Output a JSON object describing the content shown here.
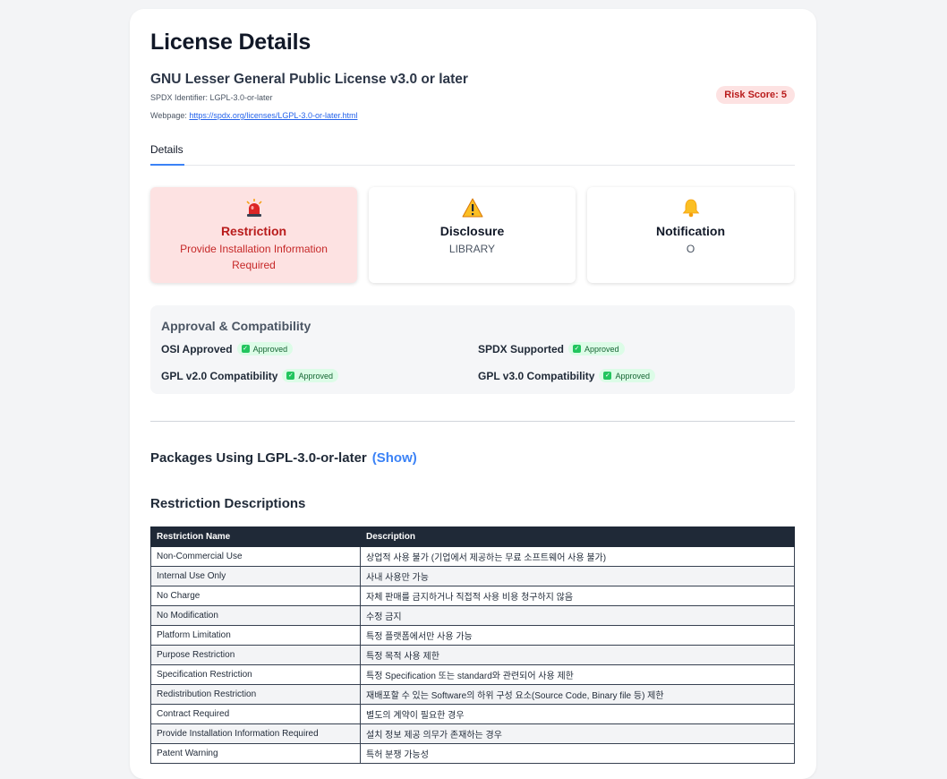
{
  "page": {
    "title": "License Details",
    "license_name": "GNU Lesser General Public License v3.0 or later",
    "spdx_label": "SPDX Identifier: ",
    "spdx_id": "LGPL-3.0-or-later",
    "webpage_label": "Webpage: ",
    "webpage_url": "https://spdx.org/licenses/LGPL-3.0-or-later.html",
    "risk_score": "Risk Score: 5"
  },
  "tabs": {
    "details": "Details"
  },
  "info_boxes": {
    "restriction": {
      "title": "Restriction",
      "value": "Provide Installation Information Required",
      "icon": "siren-icon"
    },
    "disclosure": {
      "title": "Disclosure",
      "value": "LIBRARY",
      "icon": "warning-icon"
    },
    "notification": {
      "title": "Notification",
      "value": "O",
      "icon": "bell-icon"
    }
  },
  "approval": {
    "title": "Approval & Compatibility",
    "items": [
      {
        "label": "OSI Approved",
        "status": "Approved"
      },
      {
        "label": "SPDX Supported",
        "status": "Approved"
      },
      {
        "label": "GPL v2.0 Compatibility",
        "status": "Approved"
      },
      {
        "label": "GPL v3.0 Compatibility",
        "status": "Approved"
      }
    ]
  },
  "packages": {
    "label": "Packages Using LGPL-3.0-or-later",
    "show": "(Show)"
  },
  "restrictions": {
    "heading": "Restriction Descriptions",
    "columns": [
      "Restriction Name",
      "Description"
    ],
    "rows": [
      [
        "Non-Commercial Use",
        "상업적 사용 불가 (기업에서 제공하는 무료 소프트웨어 사용 불가)"
      ],
      [
        "Internal Use Only",
        "사내 사용만 가능"
      ],
      [
        "No Charge",
        "자체 판매를 금지하거나 직접적 사용 비용 청구하지 않음"
      ],
      [
        "No Modification",
        "수정 금지"
      ],
      [
        "Platform Limitation",
        "특정 플랫폼에서만 사용 가능"
      ],
      [
        "Purpose Restriction",
        "특정 목적 사용 제한"
      ],
      [
        "Specification Restriction",
        "특정 Specification 또는 standard와 관련되어 사용 제한"
      ],
      [
        "Redistribution Restriction",
        "재배포할 수 있는 Software의 하위 구성 요소(Source Code, Binary file 등) 제한"
      ],
      [
        "Contract Required",
        "별도의 계약이 필요한 경우"
      ],
      [
        "Provide Installation Information Required",
        "설치 정보 제공 의무가 존재하는 경우"
      ],
      [
        "Patent Warning",
        "특허 분쟁 가능성"
      ]
    ]
  }
}
